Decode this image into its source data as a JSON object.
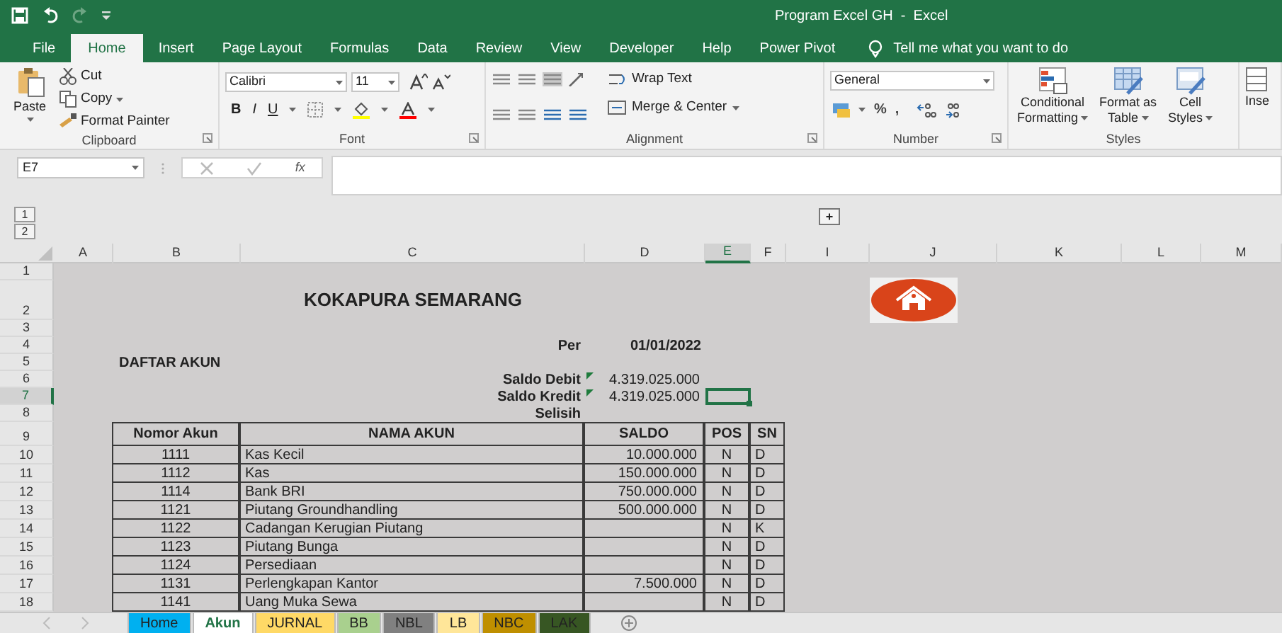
{
  "window": {
    "title": "Program Excel GH  -  Excel"
  },
  "ribbon_tabs": [
    {
      "label": "File",
      "selected": false
    },
    {
      "label": "Home",
      "selected": true
    },
    {
      "label": "Insert",
      "selected": false
    },
    {
      "label": "Page Layout",
      "selected": false
    },
    {
      "label": "Formulas",
      "selected": false
    },
    {
      "label": "Data",
      "selected": false
    },
    {
      "label": "Review",
      "selected": false
    },
    {
      "label": "View",
      "selected": false
    },
    {
      "label": "Developer",
      "selected": false
    },
    {
      "label": "Help",
      "selected": false
    },
    {
      "label": "Power Pivot",
      "selected": false
    }
  ],
  "tell_me": "Tell me what you want to do",
  "ribbon": {
    "groups": [
      {
        "kind": "clipboard",
        "label": "Clipboard",
        "launcher": true,
        "paste": "Paste",
        "items": [
          "Cut",
          "Copy",
          "Format Painter"
        ]
      },
      {
        "kind": "font",
        "label": "Font",
        "launcher": true,
        "font_name": "Calibri",
        "font_size": "11",
        "buttons": [
          "B",
          "I",
          "U"
        ]
      },
      {
        "kind": "alignment",
        "label": "Alignment",
        "launcher": true,
        "items": [
          "Wrap Text",
          "Merge & Center"
        ]
      },
      {
        "kind": "number",
        "label": "Number",
        "launcher": true,
        "format": "General",
        "symbols": [
          "%",
          ","
        ]
      },
      {
        "kind": "styles",
        "label": "Styles",
        "launcher": false,
        "items": [
          [
            "Conditional",
            "Formatting"
          ],
          [
            "Format as",
            "Table"
          ],
          [
            "Cell",
            "Styles"
          ]
        ]
      },
      {
        "kind": "cells",
        "items": [
          "Inse"
        ]
      }
    ]
  },
  "formula_bar": {
    "name_box": "E7",
    "fx": "fx"
  },
  "outline": {
    "levels": [
      "1",
      "2"
    ],
    "expand": "+"
  },
  "sheet": {
    "columns": [
      {
        "label": "A",
        "selected": false
      },
      {
        "label": "B",
        "selected": false
      },
      {
        "label": "C",
        "selected": false
      },
      {
        "label": "D",
        "selected": false
      },
      {
        "label": "E",
        "selected": true
      },
      {
        "label": "F",
        "selected": false
      },
      {
        "label": "I",
        "selected": false
      },
      {
        "label": "J",
        "selected": false
      },
      {
        "label": "K",
        "selected": false
      },
      {
        "label": "L",
        "selected": false
      },
      {
        "label": "M",
        "selected": false
      }
    ],
    "rows": [
      {
        "number": "1",
        "selected": false,
        "cells": []
      },
      {
        "number": "2",
        "selected": false,
        "cells": [
          {
            "kind": "title",
            "text": "KOKAPURA SEMARANG"
          },
          {
            "kind": "home_button"
          }
        ]
      },
      {
        "number": "3",
        "selected": false,
        "cells": []
      },
      {
        "number": "4",
        "selected": false,
        "cells": [
          {
            "kind": "label",
            "text": "Per"
          },
          {
            "kind": "date",
            "text": "01/01/2022"
          }
        ]
      },
      {
        "number": "5",
        "selected": false,
        "cells": [
          {
            "kind": "section",
            "text": "DAFTAR AKUN"
          }
        ]
      },
      {
        "number": "6",
        "selected": false,
        "cells": [
          {
            "kind": "label",
            "text": "Saldo Debit"
          },
          {
            "kind": "value",
            "text": "4.319.025.000",
            "flag": true
          }
        ]
      },
      {
        "number": "7",
        "selected": true,
        "cells": [
          {
            "kind": "label",
            "text": "Saldo Kredit"
          },
          {
            "kind": "value",
            "text": "4.319.025.000",
            "flag": true
          }
        ]
      },
      {
        "number": "8",
        "selected": false,
        "cells": [
          {
            "kind": "label",
            "text": "Selisih"
          }
        ]
      }
    ]
  },
  "account_table": {
    "header_row": {
      "number": "9",
      "selected": false
    },
    "columns": [
      "Nomor Akun",
      "NAMA AKUN",
      "SALDO",
      "POS",
      "SN"
    ],
    "rows": [
      {
        "row_number": "10",
        "row_selected": false,
        "nomor": "1111",
        "nama": "Kas Kecil",
        "saldo": "10.000.000",
        "pos": "N",
        "sn": "D"
      },
      {
        "row_number": "11",
        "row_selected": false,
        "nomor": "1112",
        "nama": "Kas",
        "saldo": "150.000.000",
        "pos": "N",
        "sn": "D"
      },
      {
        "row_number": "12",
        "row_selected": false,
        "nomor": "1114",
        "nama": "Bank BRI",
        "saldo": "750.000.000",
        "pos": "N",
        "sn": "D"
      },
      {
        "row_number": "13",
        "row_selected": false,
        "nomor": "1121",
        "nama": "Piutang Groundhandling",
        "saldo": "500.000.000",
        "pos": "N",
        "sn": "D"
      },
      {
        "row_number": "14",
        "row_selected": false,
        "nomor": "1122",
        "nama": "Cadangan Kerugian Piutang",
        "pos": "N",
        "sn": "K"
      },
      {
        "row_number": "15",
        "row_selected": false,
        "nomor": "1123",
        "nama": "Piutang Bunga",
        "pos": "N",
        "sn": "D"
      },
      {
        "row_number": "16",
        "row_selected": false,
        "nomor": "1124",
        "nama": "Persediaan",
        "pos": "N",
        "sn": "D"
      },
      {
        "row_number": "17",
        "row_selected": false,
        "nomor": "1131",
        "nama": "Perlengkapan Kantor",
        "saldo": "7.500.000",
        "pos": "N",
        "sn": "D"
      },
      {
        "row_number": "18",
        "row_selected": false,
        "nomor": "1141",
        "nama": "Uang Muka Sewa",
        "pos": "N",
        "sn": "D"
      }
    ]
  },
  "sheet_tabs": [
    {
      "label": "Home",
      "selected": false,
      "color": "#00b0f0"
    },
    {
      "label": "Akun",
      "selected": true,
      "color": "#ffffff"
    },
    {
      "label": "JURNAL",
      "selected": false,
      "color": "#ffd966"
    },
    {
      "label": "BB",
      "selected": false,
      "color": "#a9d08e"
    },
    {
      "label": "NBL",
      "selected": false,
      "color": "#808080"
    },
    {
      "label": "LB",
      "selected": false,
      "color": "#ffe699"
    },
    {
      "label": "NBC",
      "selected": false,
      "color": "#bf8f00"
    },
    {
      "label": "LAK",
      "selected": false,
      "color": "#375623"
    }
  ]
}
